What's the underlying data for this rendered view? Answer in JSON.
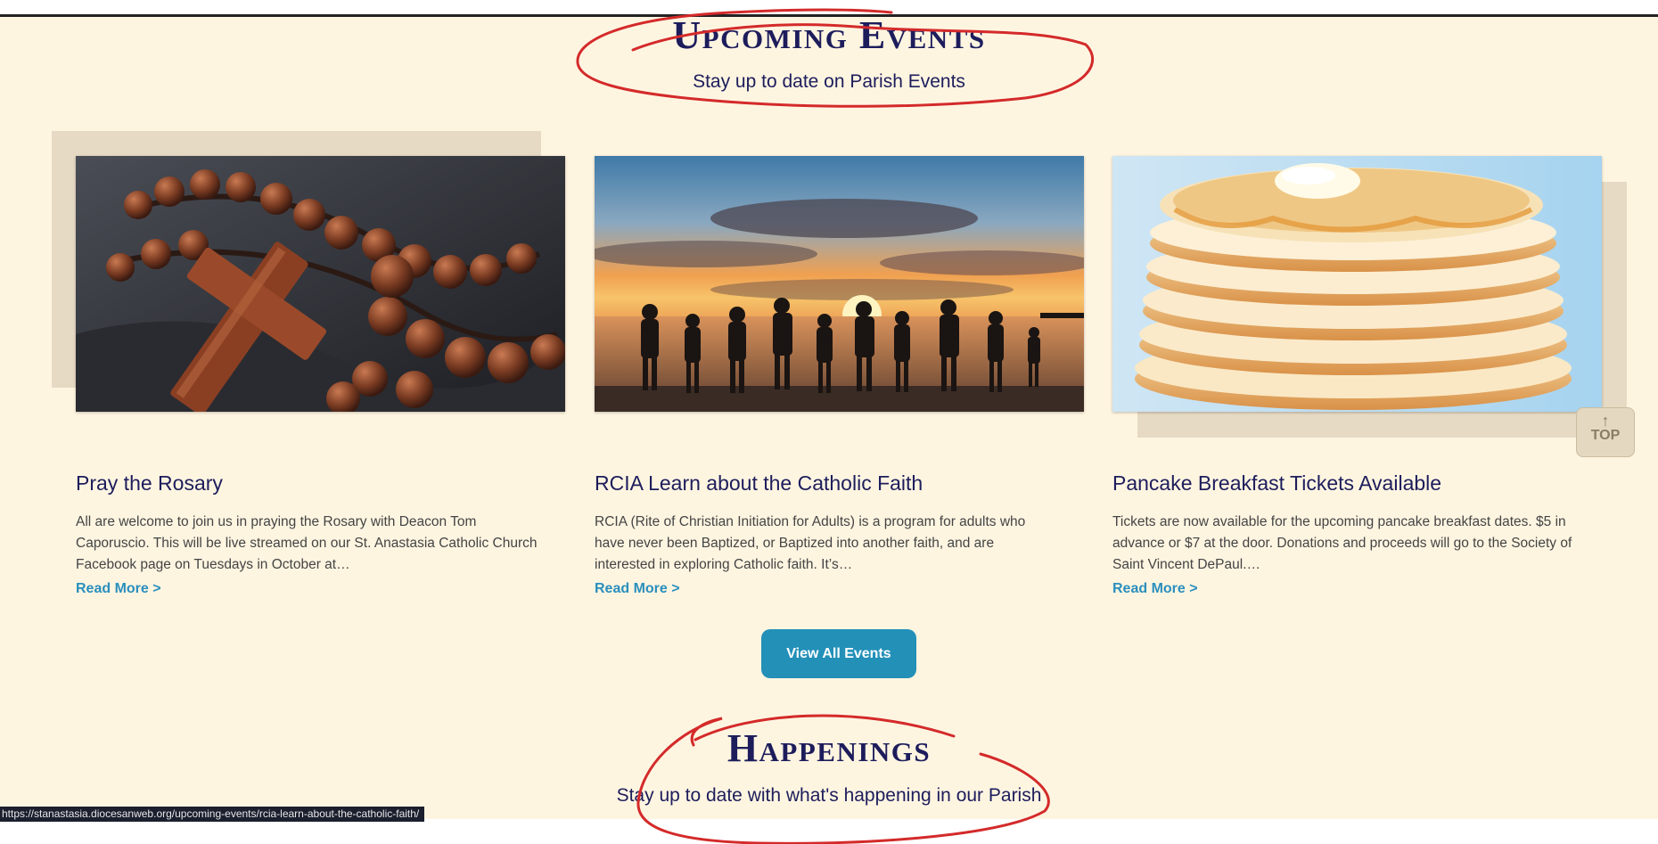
{
  "upcoming": {
    "title": "Upcoming Events",
    "subtitle": "Stay up to date on Parish Events"
  },
  "cards": [
    {
      "title": "Pray the Rosary",
      "description": "All are welcome to join  us in praying the Rosary with Deacon Tom Caporuscio. This will be live streamed on our St. Anastasia Catholic Church Facebook page on Tuesdays in October at…",
      "link": "Read More >"
    },
    {
      "title": "RCIA Learn about the Catholic Faith",
      "description": "RCIA (Rite of Christian Initiation for Adults) is a program for adults who have never been Baptized, or Baptized into another faith, and are interested in exploring Catholic faith. It’s…",
      "link": "Read More >"
    },
    {
      "title": "Pancake Breakfast Tickets Available",
      "description": "Tickets are now available for the upcoming pancake breakfast dates. $5 in advance or $7 at the door. Donations and proceeds will go to the Society of Saint Vincent DePaul.…",
      "link": "Read More >"
    }
  ],
  "view_all_label": "View All Events",
  "top_label": "TOP",
  "happenings": {
    "title": "Happenings",
    "subtitle": "Stay up to date with what's happening in our Parish"
  },
  "status_url": "https://stanastasia.diocesanweb.org/upcoming-events/rcia-learn-about-the-catholic-faith/",
  "colors": {
    "background": "#fef5e1",
    "heading": "#1d1d5c",
    "accent": "#2390b8",
    "annotation": "#d42a2a"
  },
  "icons": {
    "top": "arrow-up-icon"
  }
}
